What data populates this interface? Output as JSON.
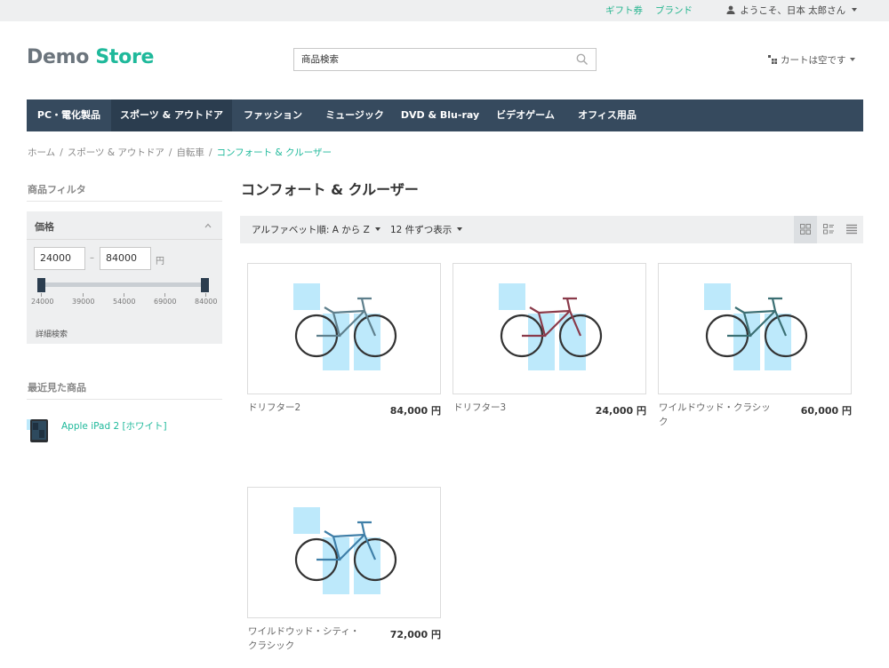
{
  "topbar": {
    "gift": "ギフト券",
    "brand": "ブランド",
    "user": "ようこそ、日本 太郎さん"
  },
  "logo": {
    "part1": "Demo",
    "part2": "Store"
  },
  "search": {
    "placeholder": "商品検索"
  },
  "cart": {
    "label": "カートは空です"
  },
  "nav": {
    "items": [
      "PC・電化製品",
      "スポーツ & アウトドア",
      "ファッション",
      "ミュージック",
      "DVD & Blu-ray",
      "ビデオゲーム",
      "オフィス用品"
    ]
  },
  "breadcrumb": [
    "ホーム",
    "スポーツ & アウトドア",
    "自転車",
    "コンフォート & クルーザー"
  ],
  "sidebar": {
    "filter_title": "商品フィルタ",
    "price_title": "価格",
    "min": "24000",
    "max": "84000",
    "dash": "–",
    "unit": "円",
    "ticks": [
      "24000",
      "39000",
      "54000",
      "69000",
      "84000"
    ],
    "advanced": "詳細検索",
    "recent_title": "最近見た商品",
    "recent_item": "Apple iPad 2 [ホワイト]"
  },
  "main": {
    "title": "コンフォート & クルーザー",
    "sort_label": "アルファベット順: A から Z",
    "per_page_label": "12 件ずつ表示"
  },
  "products": [
    {
      "name": "ドリフター2",
      "price": "84,000 円",
      "frame_color": "#5e7f8c"
    },
    {
      "name": "ドリフター3",
      "price": "24,000 円",
      "frame_color": "#8a3a4a"
    },
    {
      "name": "ワイルドウッド・クラシック",
      "price": "60,000 円",
      "frame_color": "#3b6f73"
    },
    {
      "name": "ワイルドウッド・シティ・クラシック",
      "price": "72,000 円",
      "frame_color": "#3f7fa8"
    }
  ],
  "colors": {
    "accent": "#1fb99b",
    "nav_bg": "#364a5e",
    "nav_active": "#2b3d4f",
    "panel_bg": "#eeeff0",
    "placeholder_blue": "#bde9fb"
  }
}
